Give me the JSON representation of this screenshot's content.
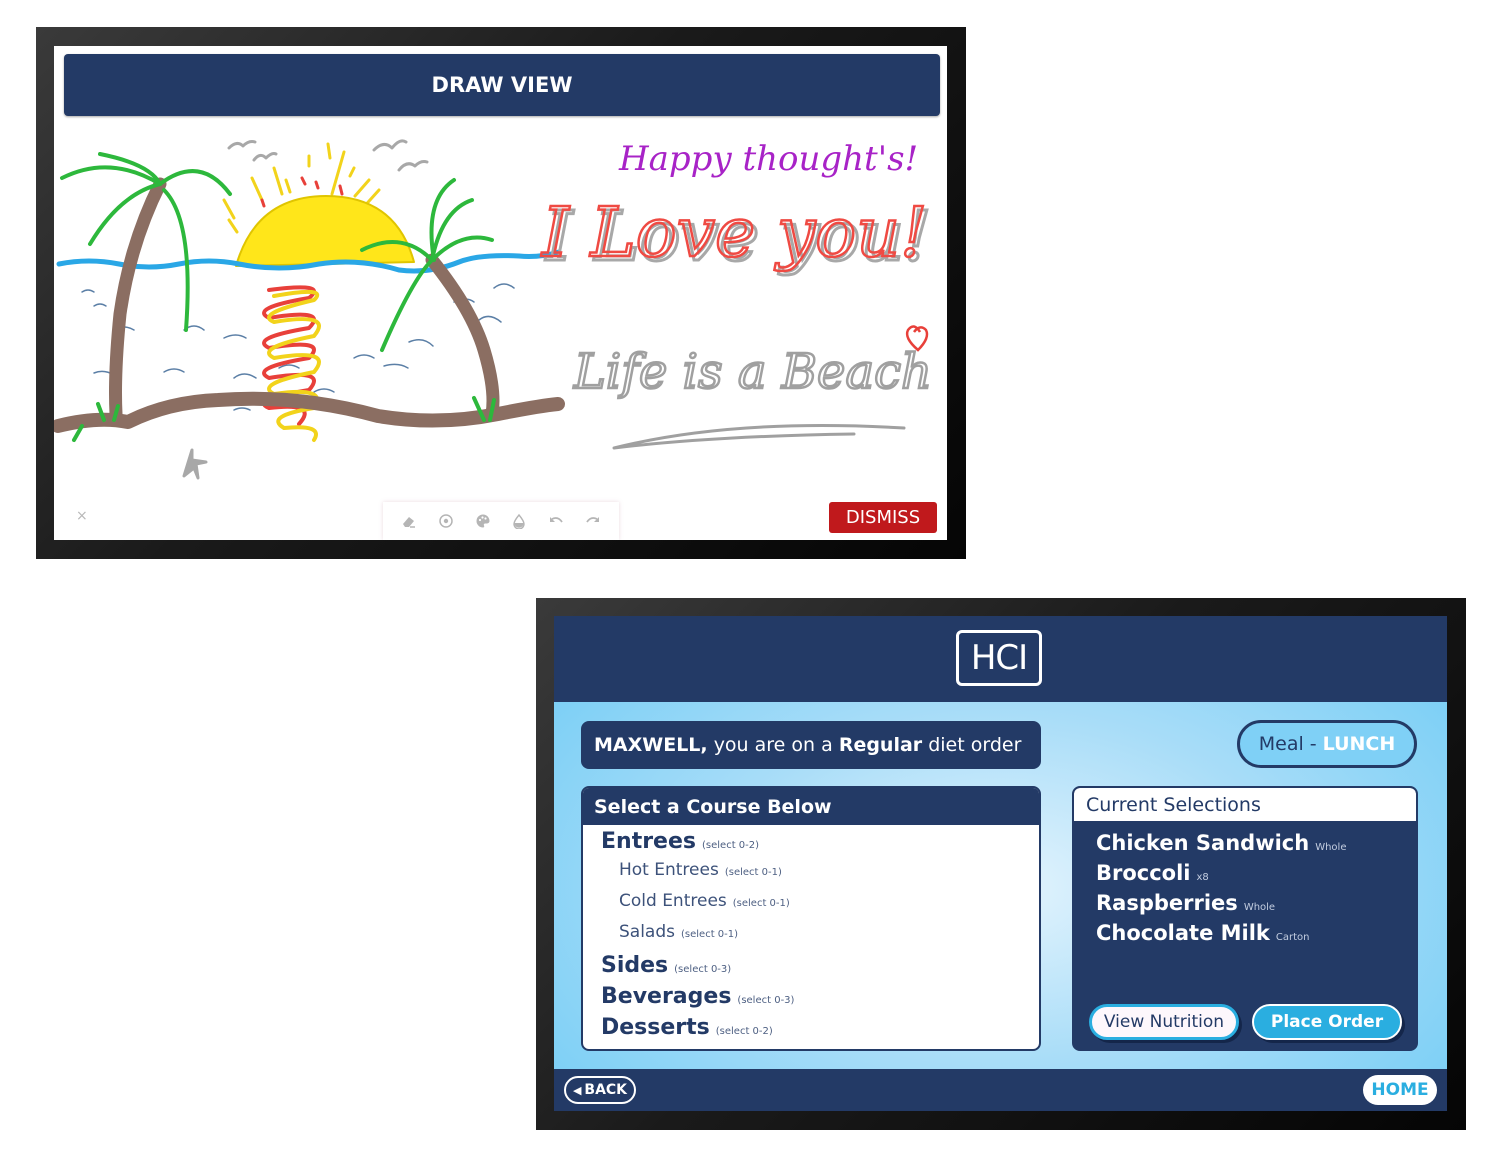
{
  "draw_view": {
    "title": "DRAW VIEW",
    "canvas_text": {
      "purple_note": "Happy thought's!",
      "red_note": "I Love you!",
      "gray_note": "Life is a Beach"
    },
    "toolbar": [
      {
        "icon": "eraser-icon",
        "label": "Eraser"
      },
      {
        "icon": "brush-size-icon",
        "label": "Brush size"
      },
      {
        "icon": "palette-icon",
        "label": "Color palette"
      },
      {
        "icon": "opacity-icon",
        "label": "Opacity"
      },
      {
        "icon": "undo-icon",
        "label": "Undo"
      },
      {
        "icon": "redo-icon",
        "label": "Redo"
      }
    ],
    "close_glyph": "×",
    "dismiss_label": "DISMISS",
    "colors": {
      "header": "#233a66",
      "dismiss": "#c0191c"
    }
  },
  "meal_app": {
    "logo": "HCI",
    "greeting": {
      "name": "MAXWELL,",
      "middle": "you are on a",
      "diet": "Regular",
      "end": "diet order"
    },
    "meal": {
      "prefix": "Meal -",
      "value": "LUNCH"
    },
    "course_panel": {
      "title": "Select a Course Below",
      "courses": [
        {
          "name": "Entrees",
          "hint": "(select 0-2)",
          "level": 0
        },
        {
          "name": "Hot Entrees",
          "hint": "(select 0-1)",
          "level": 1
        },
        {
          "name": "Cold Entrees",
          "hint": "(select 0-1)",
          "level": 1
        },
        {
          "name": "Salads",
          "hint": "(select 0-1)",
          "level": 1
        },
        {
          "name": "Sides",
          "hint": "(select 0-3)",
          "level": 0
        },
        {
          "name": "Beverages",
          "hint": "(select 0-3)",
          "level": 0
        },
        {
          "name": "Desserts",
          "hint": "(select 0-2)",
          "level": 0
        }
      ]
    },
    "selections_panel": {
      "title": "Current Selections",
      "items": [
        {
          "name": "Chicken Sandwich",
          "qualifier": "Whole"
        },
        {
          "name": "Broccoli",
          "qualifier": "x8"
        },
        {
          "name": "Raspberries",
          "qualifier": "Whole"
        },
        {
          "name": "Chocolate Milk",
          "qualifier": "Carton"
        }
      ],
      "view_nutrition_label": "View Nutrition",
      "place_order_label": "Place Order"
    },
    "footer": {
      "back_label": "BACK",
      "back_glyph": "◀",
      "home_label": "HOME"
    },
    "colors": {
      "navy": "#233a66",
      "accent": "#2aaee0",
      "sky": "#6ecbf5"
    }
  }
}
